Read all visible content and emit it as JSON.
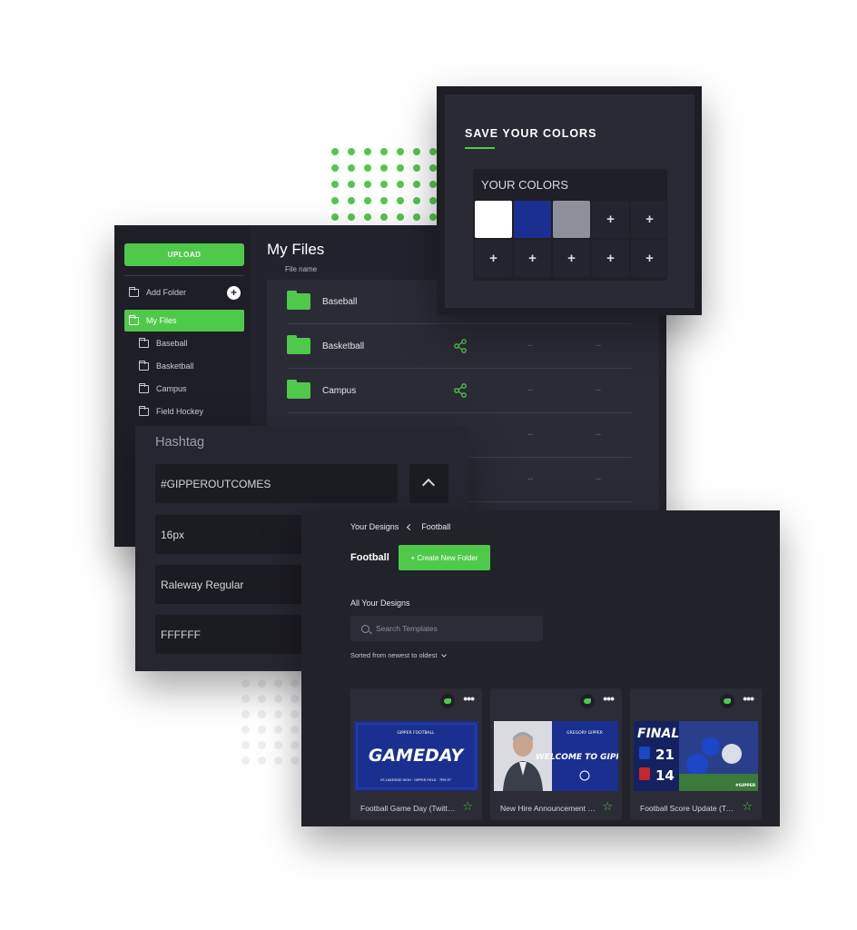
{
  "files_panel": {
    "upload_label": "UPLOAD",
    "add_folder_label": "Add Folder",
    "add_folder_plus": "+",
    "title": "My Files",
    "column_file_name": "File name",
    "sidebar_items": [
      {
        "label": "My Files"
      },
      {
        "label": "Baseball"
      },
      {
        "label": "Basketball"
      },
      {
        "label": "Campus"
      },
      {
        "label": "Field Hockey"
      }
    ],
    "rows": [
      {
        "name": "Baseball"
      },
      {
        "name": "Basketball",
        "col2": "--",
        "col3": "--"
      },
      {
        "name": "Campus",
        "col2": "--",
        "col3": "--"
      },
      {
        "name": "",
        "col2": "--",
        "col3": "--"
      },
      {
        "name": "",
        "col2": "--",
        "col3": "--"
      }
    ]
  },
  "colors_panel": {
    "title": "SAVE YOUR COLORS",
    "palette_label": "YOUR COLORS",
    "swatches": [
      {
        "color": "#ffffff",
        "label": ""
      },
      {
        "color": "#1a2f8f",
        "label": ""
      },
      {
        "color": "#8d8f99",
        "label": ""
      },
      {
        "color": "",
        "label": "+"
      },
      {
        "color": "",
        "label": "+"
      },
      {
        "color": "",
        "label": "+"
      },
      {
        "color": "",
        "label": "+"
      },
      {
        "color": "",
        "label": "+"
      },
      {
        "color": "",
        "label": "+"
      },
      {
        "color": "",
        "label": "+"
      }
    ]
  },
  "hashtag_panel": {
    "title": "Hashtag",
    "hashtag_value": "#GIPPEROUTCOMES",
    "font_size_value": "16px",
    "font_family_value": "Raleway Regular",
    "color_value": "FFFFFF"
  },
  "designs_panel": {
    "breadcrumb_root": "Your Designs",
    "breadcrumb_current": "Football",
    "title": "Football",
    "create_folder_label": "+ Create New Folder",
    "all_designs_label": "All Your Designs",
    "search_placeholder": "Search Templates",
    "sort_label": "Sorted from newest to oldest",
    "cards": [
      {
        "title": "Football Game Day (Twitter)",
        "thumb_text": "GAMEDAY",
        "thumb_small": "GIPPER FOOTBALL",
        "thumb_footer": "VS LAKESIDE HIGH · GIPPER FIELD · 7PM ET"
      },
      {
        "title": "New Hire Announcement (Twitter)",
        "thumb_text": "WELCOME TO GIPPER",
        "thumb_small": "GREGORY GIPPER"
      },
      {
        "title": "Football Score Update (Twitter)",
        "thumb_text": "FINAL",
        "score_home": "21",
        "score_away": "14",
        "thumb_small": "#GIPPER"
      }
    ]
  },
  "colors": {
    "accent": "#4fc94a",
    "panel_dark": "#22222c",
    "brand_blue": "#1a2f8f"
  }
}
